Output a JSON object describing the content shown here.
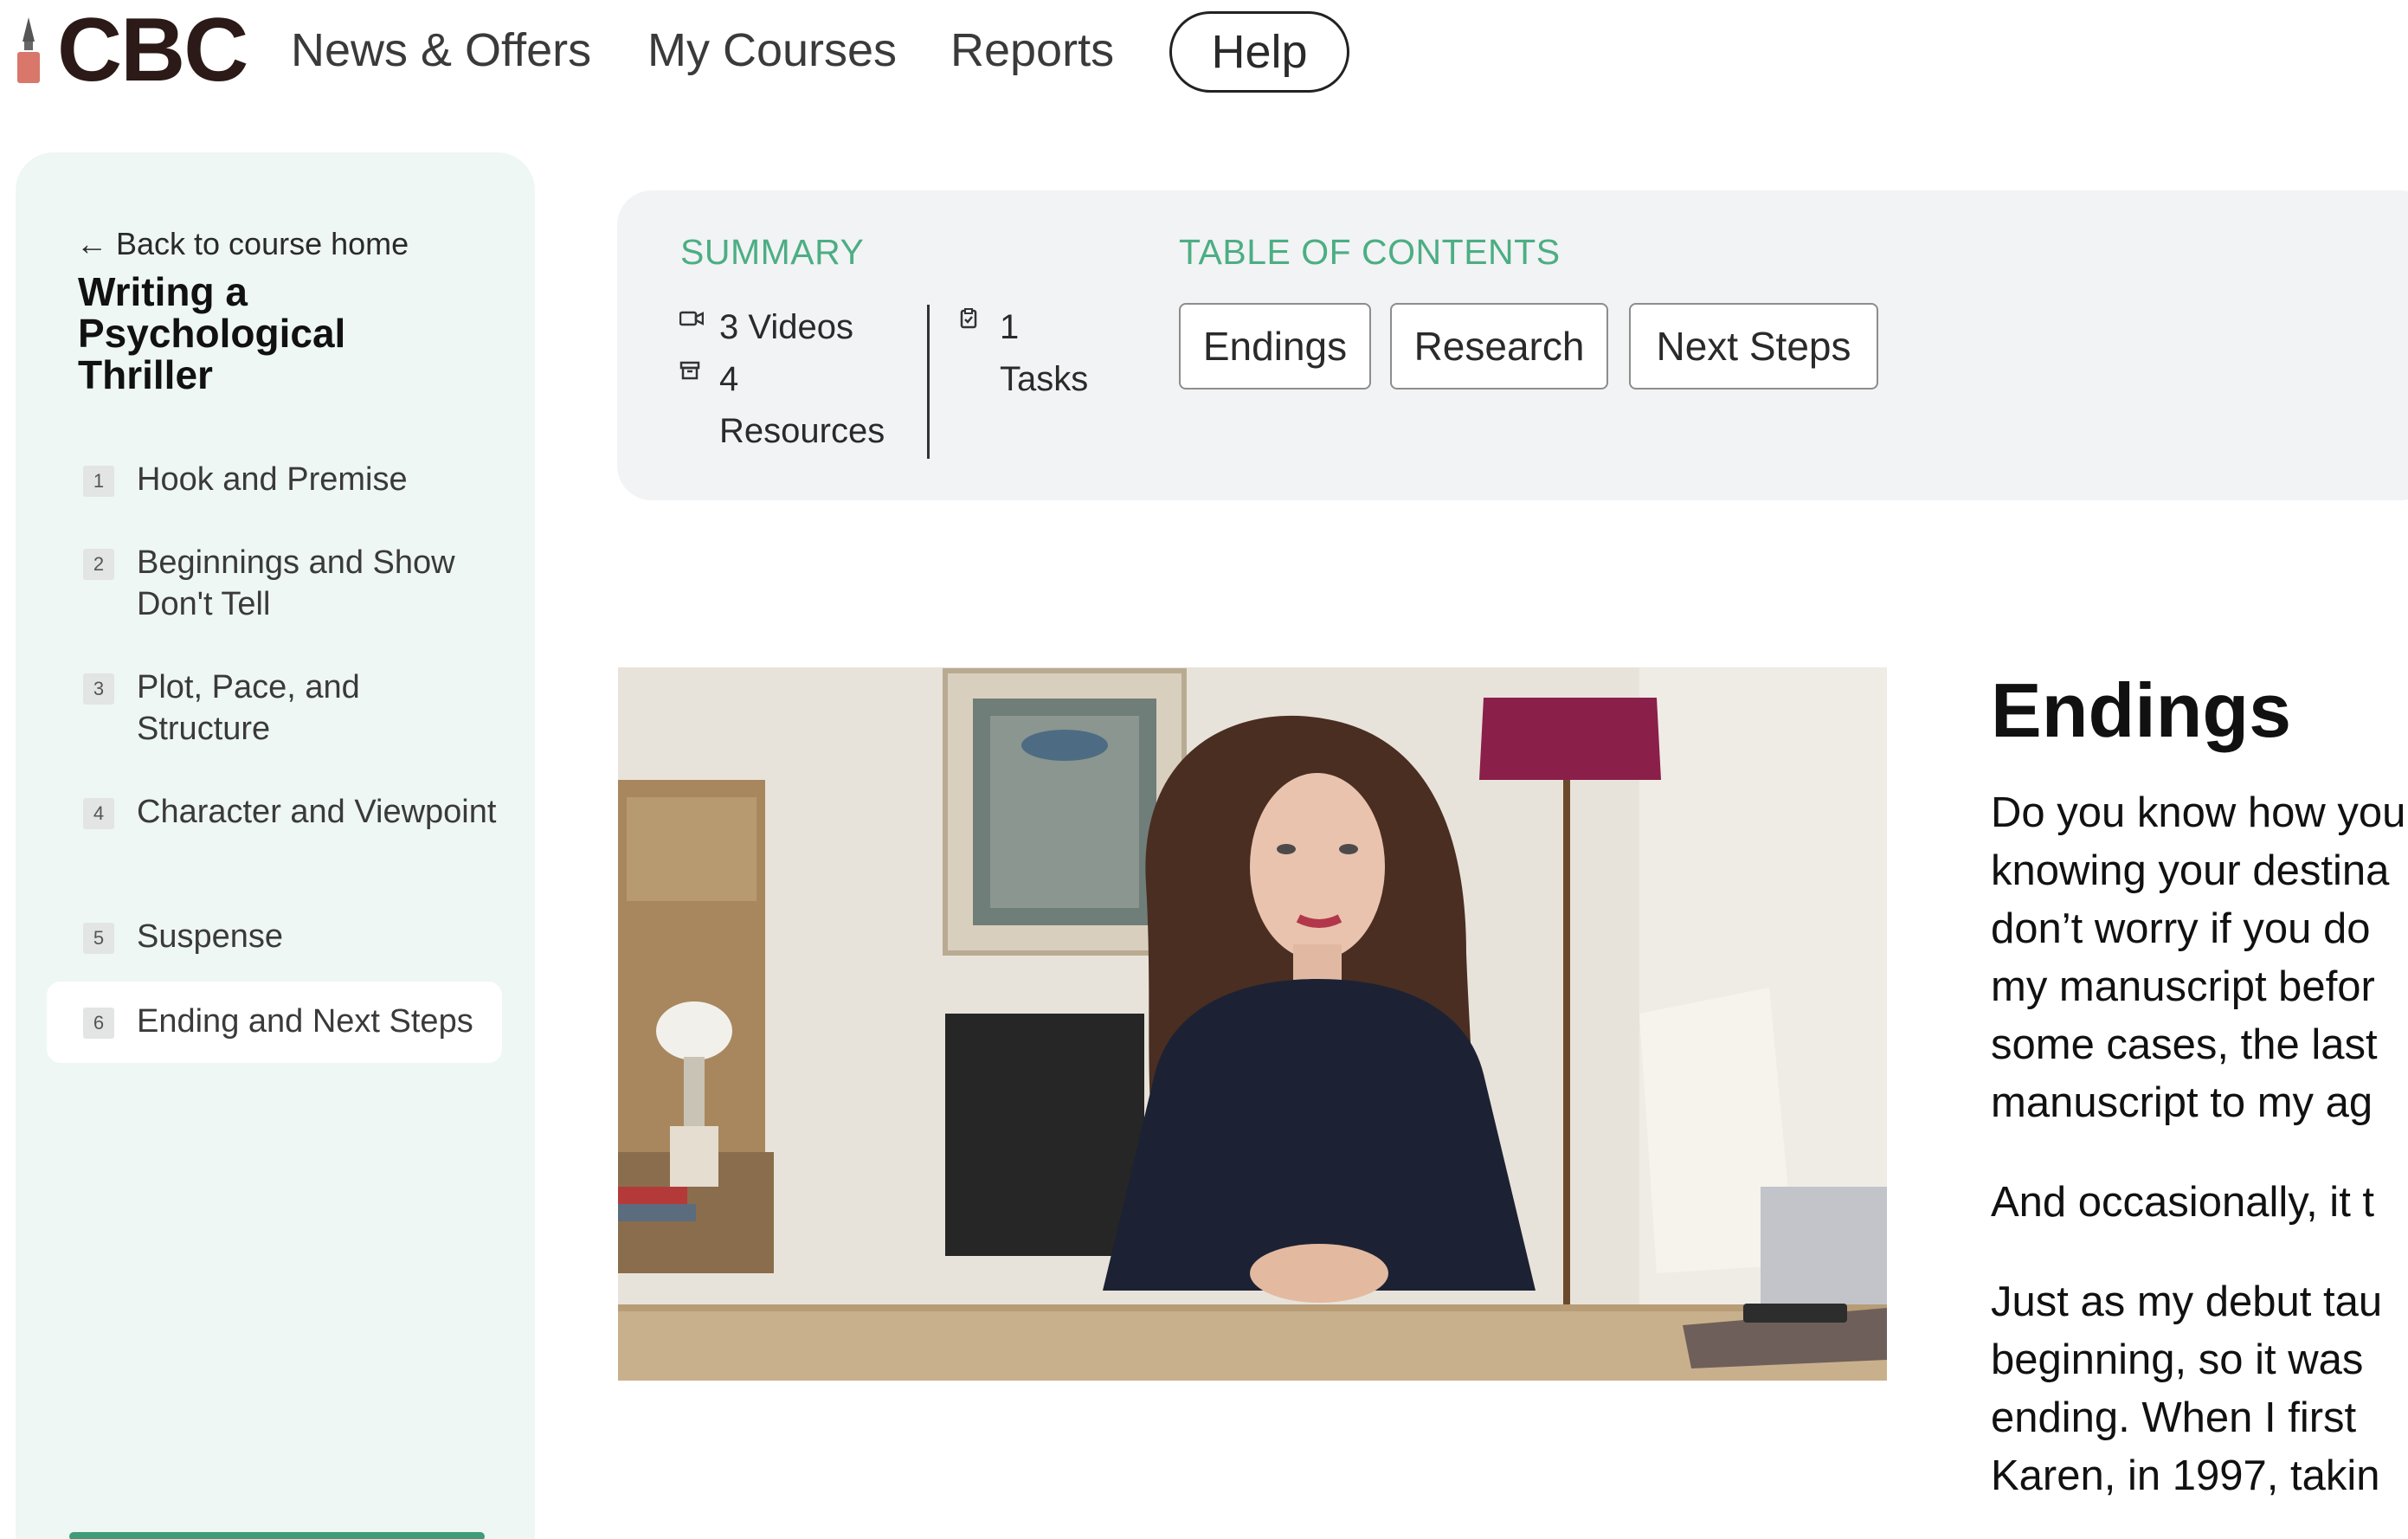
{
  "brand": {
    "logo_text": "CBC",
    "accent": "#4cae84",
    "sidebar_bg": "#eef7f3"
  },
  "nav": {
    "links": [
      "News & Offers",
      "My Courses",
      "Reports"
    ],
    "help_label": "Help"
  },
  "sidebar": {
    "back_label": "Back to course home",
    "course_title": "Writing a Psychological Thriller",
    "lessons": [
      {
        "num": "1",
        "label": "Hook and Premise"
      },
      {
        "num": "2",
        "label": "Beginnings and Show Don't Tell"
      },
      {
        "num": "3",
        "label": "Plot, Pace, and Structure"
      },
      {
        "num": "4",
        "label": "Character and Viewpoint"
      },
      {
        "num": "5",
        "label": "Suspense"
      },
      {
        "num": "6",
        "label": "Ending and Next Steps",
        "active": true
      }
    ]
  },
  "summary": {
    "heading": "SUMMARY",
    "videos": "3 Videos",
    "resources_count": "4",
    "resources_label": "Resources",
    "tasks_count": "1",
    "tasks_label": "Tasks"
  },
  "toc": {
    "heading": "TABLE OF CONTENTS",
    "items": [
      "Endings",
      "Research",
      "Next Steps"
    ]
  },
  "video": {
    "icon": "video-thumbnail"
  },
  "article": {
    "title": "Endings",
    "paragraphs": [
      [
        "Do you know how you",
        "knowing your destina",
        "don’t worry if you do",
        "my manuscript befor",
        "some cases, the last",
        "manuscript to my ag"
      ],
      [
        "And occasionally, it t"
      ],
      [
        "Just as my debut tau",
        "beginning, so it was",
        "ending. When I first",
        "Karen, in 1997, takin"
      ]
    ]
  }
}
